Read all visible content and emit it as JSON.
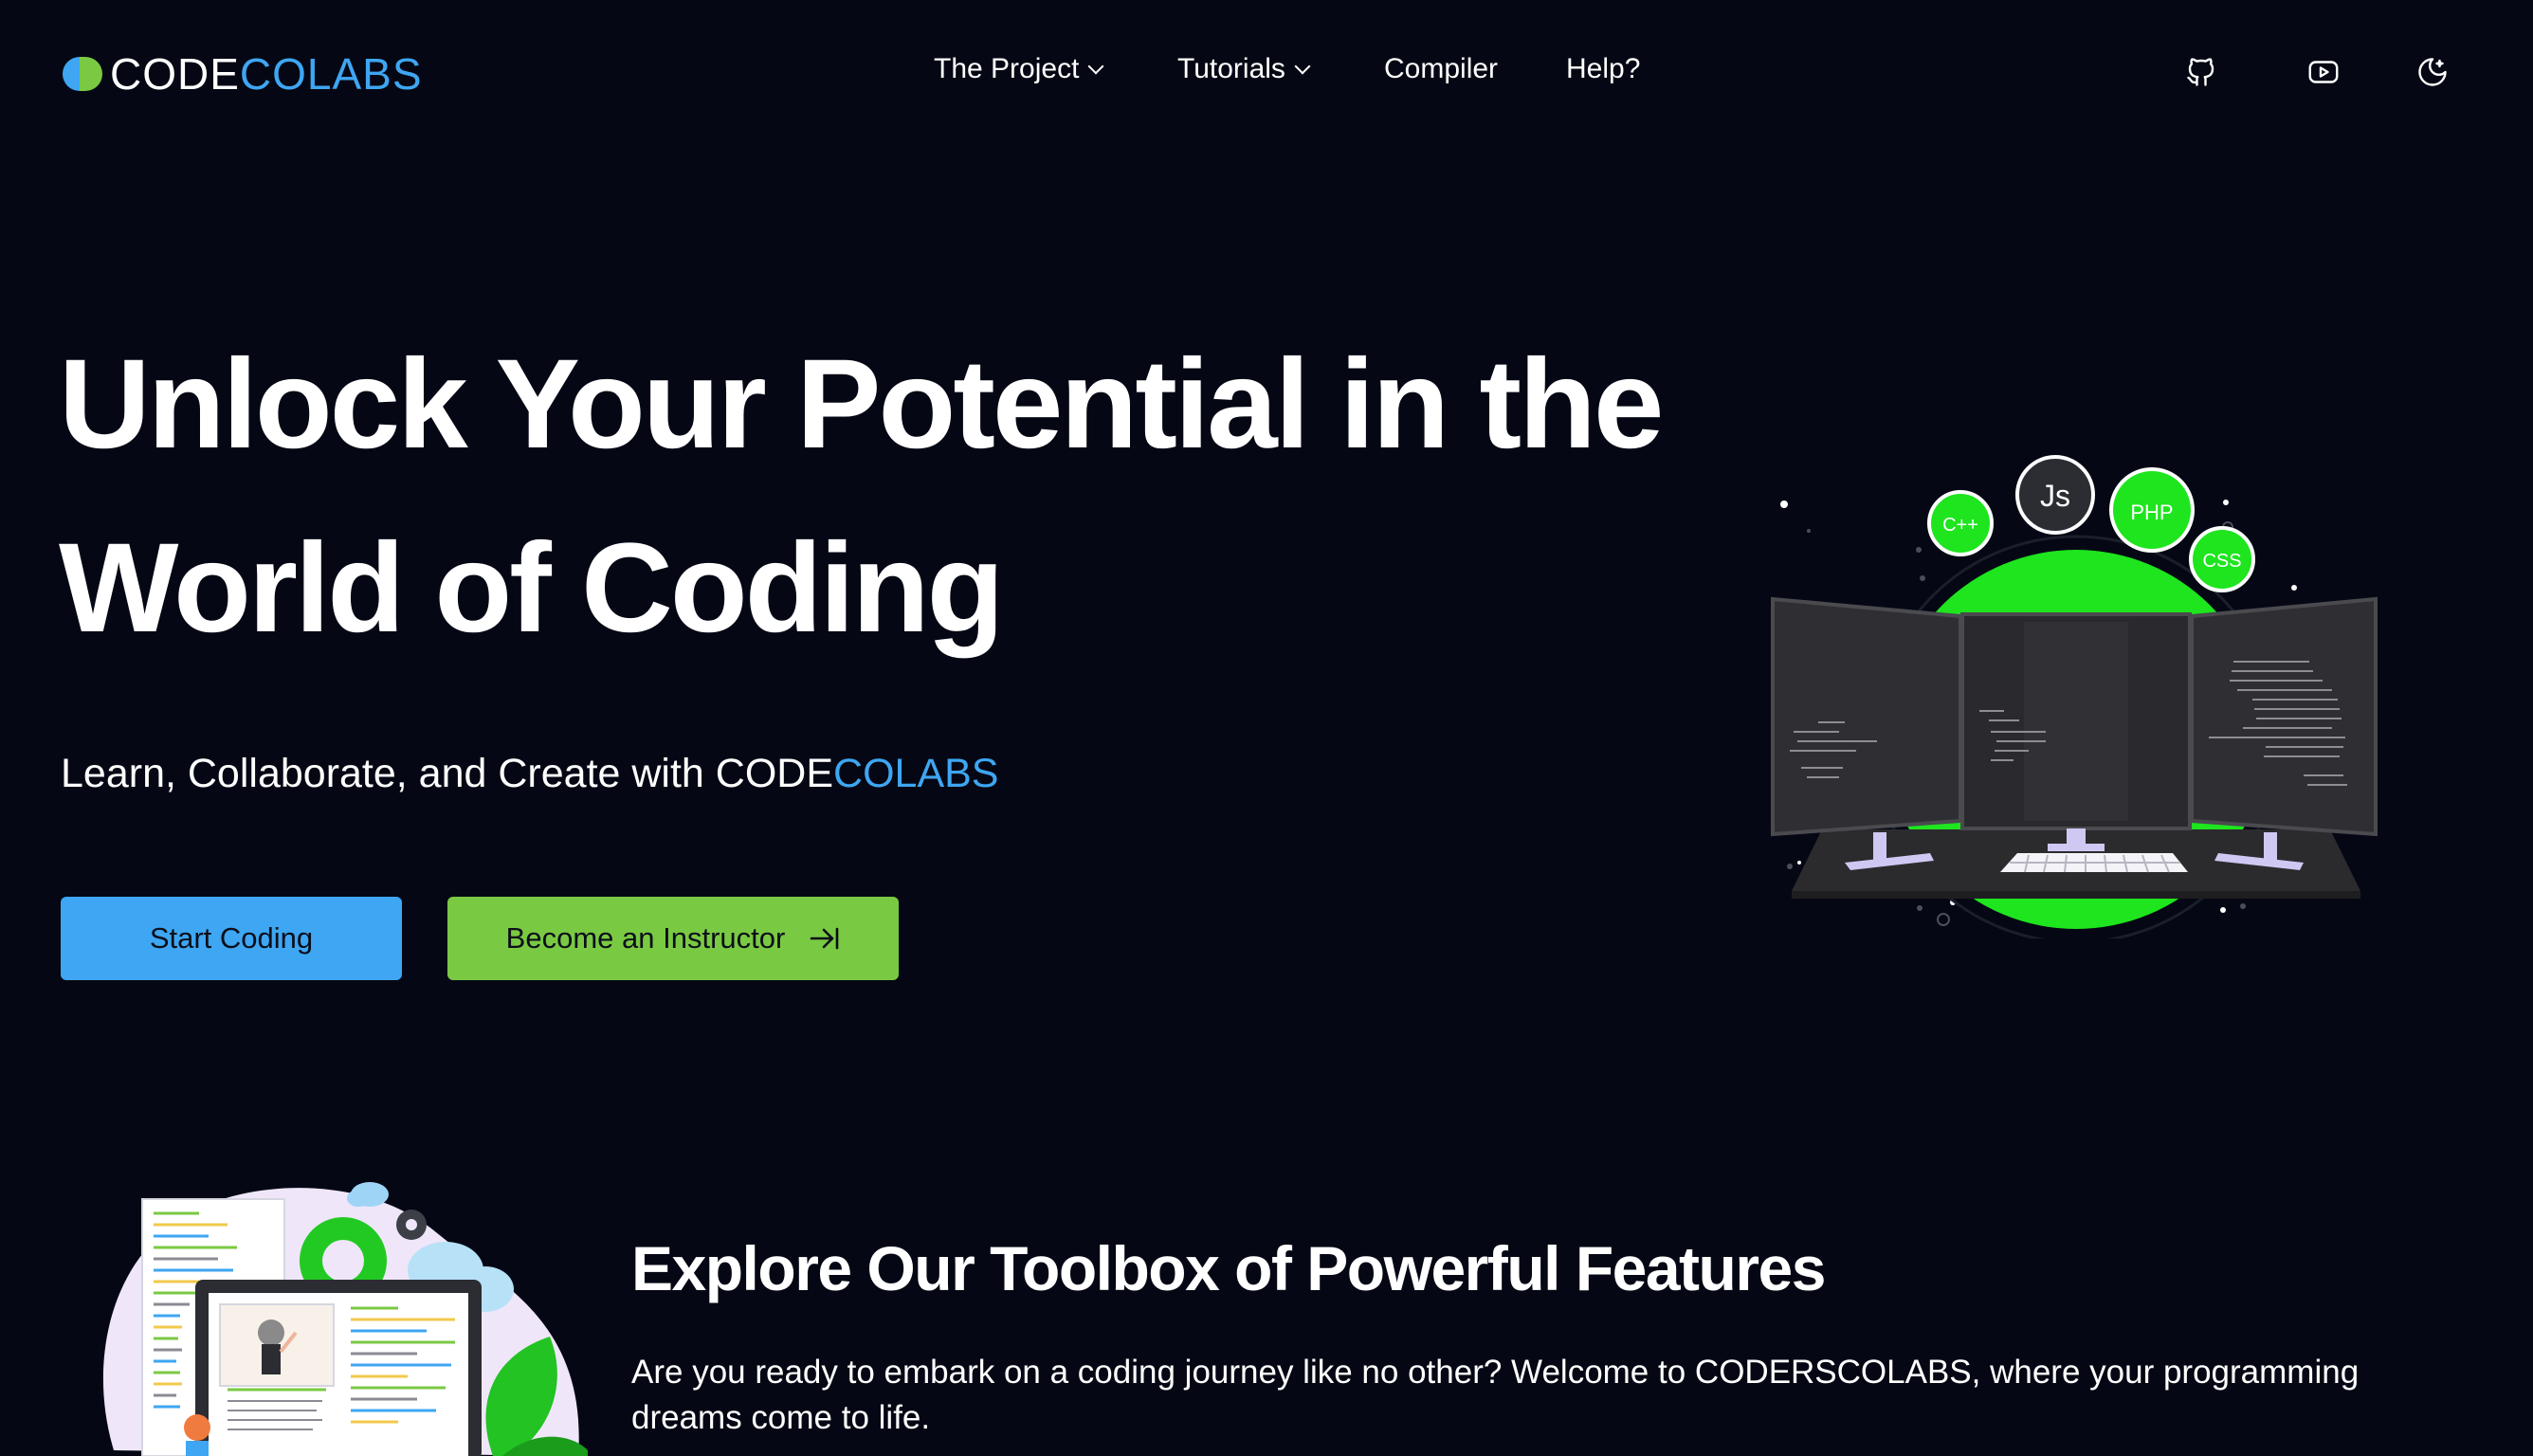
{
  "brand": {
    "logo_part1": "CODE",
    "logo_part2": "COLABS",
    "accent_blue": "#3ea6f2",
    "accent_green": "#7ac943"
  },
  "nav": {
    "items": [
      {
        "label": "The Project",
        "dropdown": true
      },
      {
        "label": "Tutorials",
        "dropdown": true
      },
      {
        "label": "Compiler",
        "dropdown": false
      },
      {
        "label": "Help?",
        "dropdown": false
      }
    ],
    "icons": [
      "github-icon",
      "youtube-icon",
      "theme-toggle-icon"
    ]
  },
  "hero": {
    "title": "Unlock Your Potential in the World of Coding",
    "subtitle_prefix": "Learn, Collaborate, and Create with ",
    "subtitle_brand1": "CODE",
    "subtitle_brand2": "COLABS",
    "primary_button": "Start Coding",
    "secondary_button": "Become an Instructor",
    "bubbles": [
      "C++",
      "Js",
      "PHP",
      "CSS"
    ]
  },
  "features": {
    "title": "Explore Our Toolbox of Powerful Features",
    "description": "Are you ready to embark on a coding journey like no other? Welcome to CODERSCOLABS, where your programming dreams come to life."
  }
}
